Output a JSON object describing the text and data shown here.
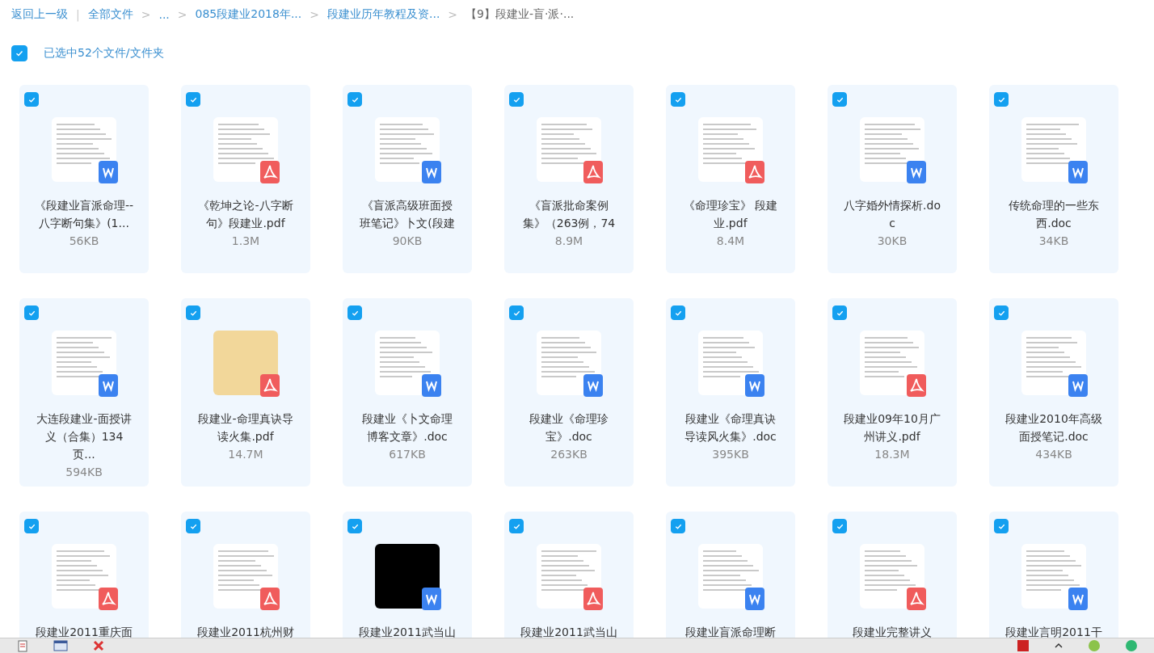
{
  "breadcrumb": {
    "back": "返回上一级",
    "divider": "|",
    "items": [
      {
        "label": "全部文件",
        "current": false
      },
      {
        "sep": ">",
        "label": "...",
        "current": false
      },
      {
        "sep": ">",
        "label": "085段建业2018年...",
        "current": false
      },
      {
        "sep": ">",
        "label": "段建业历年教程及资...",
        "current": false
      },
      {
        "sep": ">",
        "label": "【9】段建业-盲·派·...",
        "current": true
      }
    ]
  },
  "selection": {
    "checked": true,
    "label": "已选中52个文件/文件夹"
  },
  "files": [
    {
      "name": "《段建业盲派命理--八字断句集》(1...",
      "size": "56KB",
      "kind": "doc",
      "preview": {
        "kind": "page"
      },
      "checked": true
    },
    {
      "name": "《乾坤之论-八字断句》段建业.pdf",
      "size": "1.3M",
      "kind": "pdf",
      "preview": {
        "kind": "page"
      },
      "checked": true
    },
    {
      "name": "《盲派高级班面授班笔记》卜文(段建",
      "size": "90KB",
      "kind": "doc",
      "preview": {
        "kind": "page"
      },
      "checked": true
    },
    {
      "name": "《盲派批命案例集》（263例，74",
      "size": "8.9M",
      "kind": "pdf",
      "preview": {
        "kind": "page"
      },
      "checked": true
    },
    {
      "name": "《命理珍宝》 段建业.pdf",
      "size": "8.4M",
      "kind": "pdf",
      "preview": {
        "kind": "page"
      },
      "checked": true
    },
    {
      "name": "八字婚外情探析.doc",
      "size": "30KB",
      "kind": "doc",
      "preview": {
        "kind": "page"
      },
      "checked": true
    },
    {
      "name": "传统命理的一些东西.doc",
      "size": "34KB",
      "kind": "doc",
      "preview": {
        "kind": "page"
      },
      "checked": true
    },
    {
      "name": "大连段建业-面授讲义（合集）134页...",
      "size": "594KB",
      "kind": "doc",
      "preview": {
        "kind": "page"
      },
      "checked": true
    },
    {
      "name": "段建业-命理真诀导读火集.pdf",
      "size": "14.7M",
      "kind": "pdf",
      "preview": {
        "kind": "cover"
      },
      "checked": true
    },
    {
      "name": "段建业《卜文命理博客文章》.doc",
      "size": "617KB",
      "kind": "doc",
      "preview": {
        "kind": "page"
      },
      "checked": true
    },
    {
      "name": "段建业《命理珍宝》.doc",
      "size": "263KB",
      "kind": "doc",
      "preview": {
        "kind": "page"
      },
      "checked": true
    },
    {
      "name": "段建业《命理真诀导读风火集》.doc",
      "size": "395KB",
      "kind": "doc",
      "preview": {
        "kind": "page"
      },
      "checked": true
    },
    {
      "name": "段建业09年10月广州讲义.pdf",
      "size": "18.3M",
      "kind": "pdf",
      "preview": {
        "kind": "page"
      },
      "checked": true
    },
    {
      "name": "段建业2010年高级面授笔记.doc",
      "size": "434KB",
      "kind": "doc",
      "preview": {
        "kind": "page"
      },
      "checked": true
    },
    {
      "name": "段建业2011重庆面",
      "kind": "pdf",
      "preview": {
        "kind": "page"
      },
      "checked": true
    },
    {
      "name": "段建业2011杭州财",
      "kind": "pdf",
      "preview": {
        "kind": "page"
      },
      "checked": true
    },
    {
      "name": "段建业2011武当山",
      "kind": "doc",
      "preview": {
        "kind": "dark"
      },
      "checked": true
    },
    {
      "name": "段建业2011武当山",
      "kind": "pdf",
      "preview": {
        "kind": "page"
      },
      "checked": true
    },
    {
      "name": "段建业盲派命理断",
      "kind": "doc",
      "preview": {
        "kind": "page"
      },
      "checked": true
    },
    {
      "name": "段建业完整讲义",
      "kind": "pdf",
      "preview": {
        "kind": "page"
      },
      "checked": true
    },
    {
      "name": "段建业言明2011干",
      "kind": "doc",
      "preview": {
        "kind": "page"
      },
      "checked": true
    }
  ]
}
